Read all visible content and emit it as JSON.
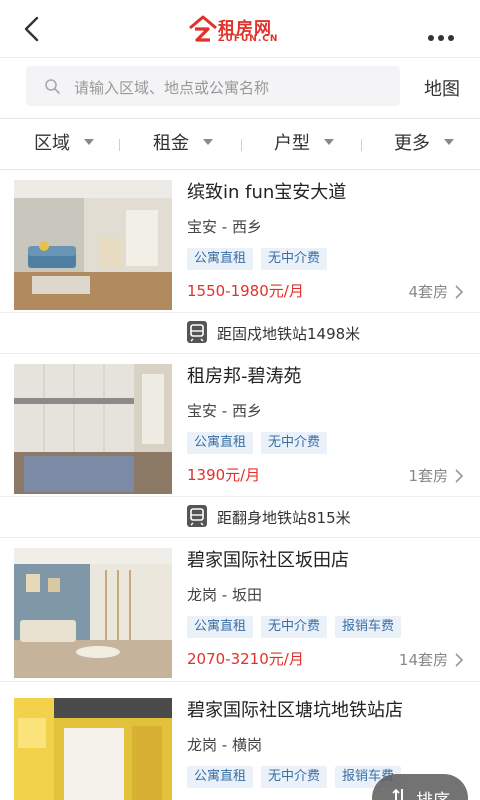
{
  "header": {
    "logo_name": "租房网",
    "logo_domain": "ZUFUN.CN"
  },
  "search": {
    "placeholder": "请输入区域、地点或公寓名称",
    "map_label": "地图"
  },
  "filters": [
    {
      "label": "区域"
    },
    {
      "label": "租金"
    },
    {
      "label": "户型"
    },
    {
      "label": "更多"
    }
  ],
  "listings": [
    {
      "title": "缤致in fun宝安大道",
      "location": "宝安 - 西乡",
      "tags": [
        "公寓直租",
        "无中介费"
      ],
      "price": "1550-1980元/月",
      "count": "4套房",
      "metro": "距固戍地铁站1498米"
    },
    {
      "title": "租房邦-碧涛苑",
      "location": "宝安 - 西乡",
      "tags": [
        "公寓直租",
        "无中介费"
      ],
      "price": "1390元/月",
      "count": "1套房",
      "metro": "距翻身地铁站815米"
    },
    {
      "title": "碧家国际社区坂田店",
      "location": "龙岗 - 坂田",
      "tags": [
        "公寓直租",
        "无中介费",
        "报销车费"
      ],
      "price": "2070-3210元/月",
      "count": "14套房"
    },
    {
      "title": "碧家国际社区塘坑地铁站店",
      "location": "龙岗 - 横岗",
      "tags": [
        "公寓直租",
        "无中介费",
        "报销车费"
      ]
    }
  ],
  "sort": {
    "label": "排序"
  },
  "colors": {
    "brand_red": "#e0312a",
    "tag_text": "#3a6fa6",
    "tag_bg": "#eaf1f8"
  }
}
